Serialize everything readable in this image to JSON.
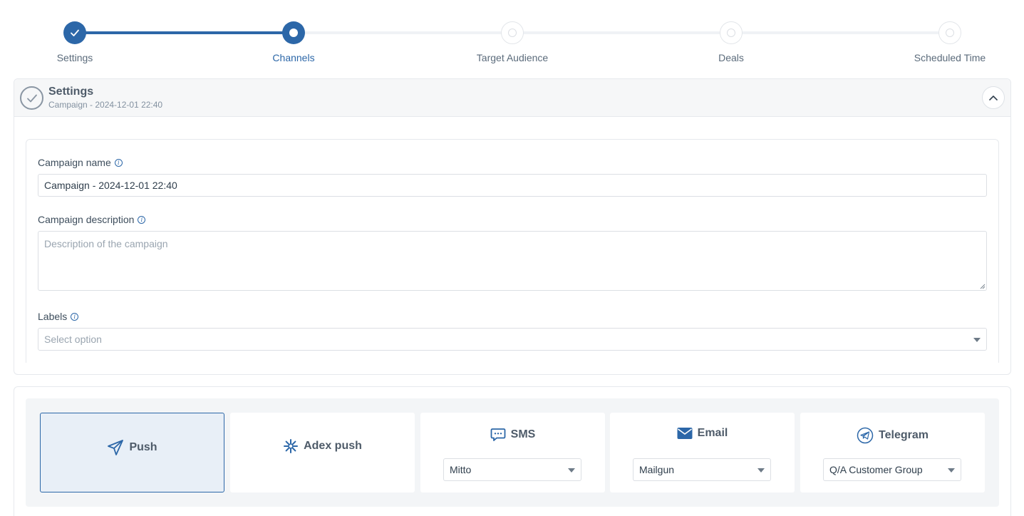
{
  "stepper": {
    "steps": [
      {
        "label": "Settings",
        "state": "done"
      },
      {
        "label": "Channels",
        "state": "current"
      },
      {
        "label": "Target Audience",
        "state": "todo"
      },
      {
        "label": "Deals",
        "state": "todo"
      },
      {
        "label": "Scheduled Time",
        "state": "todo"
      }
    ]
  },
  "settings": {
    "title": "Settings",
    "subtitle": "Campaign - 2024-12-01 22:40",
    "campaign_name_label": "Campaign name",
    "campaign_name_value": "Campaign - 2024-12-01 22:40",
    "campaign_description_label": "Campaign description",
    "campaign_description_placeholder": "Description of the campaign",
    "labels_label": "Labels",
    "labels_placeholder": "Select option"
  },
  "channels": {
    "items": [
      {
        "label": "Push",
        "icon": "send-icon",
        "selected": true
      },
      {
        "label": "Adex push",
        "icon": "snowflake-icon",
        "selected": false
      },
      {
        "label": "SMS",
        "icon": "chat-icon",
        "selected": false,
        "provider": "Mitto"
      },
      {
        "label": "Email",
        "icon": "envelope-icon",
        "selected": false,
        "provider": "Mailgun"
      },
      {
        "label": "Telegram",
        "icon": "telegram-icon",
        "selected": false,
        "provider": "Q/A Customer Group"
      }
    ]
  },
  "colors": {
    "accent": "#2c67a8",
    "selected_bg": "#e8eff7",
    "header_bg": "#f6f7f8"
  }
}
